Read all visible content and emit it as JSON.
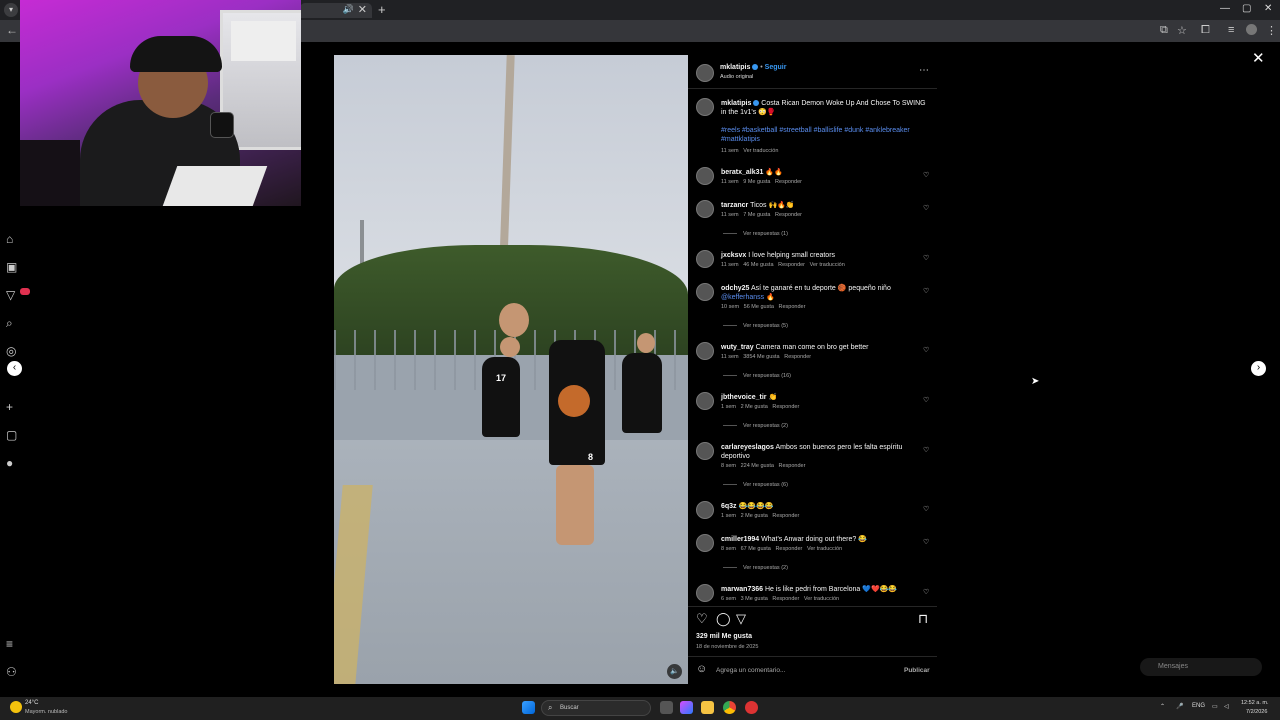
{
  "browser": {
    "tab_mute_icon": "speaker-icon",
    "tab_close": "✕",
    "new_tab": "+",
    "window_controls": [
      "—",
      "▢",
      "✕"
    ]
  },
  "post": {
    "author": "mklatipis",
    "follow": "Seguir",
    "audio": "Audio original",
    "caption_user": "mklatipis",
    "caption_text": "Costa Rican Demon Woke Up And Chose To SWING in the 1v1's 😳🥊",
    "hashtags": "#reels #basketball #streetball #ballislife #dunk #anklebreaker #mattklatipis",
    "caption_time": "11 sem",
    "caption_translate": "Ver traducción",
    "likes": "329 mil Me gusta",
    "date": "18 de noviembre de 2025",
    "comment_placeholder": "Agrega un comentario...",
    "publish": "Publicar"
  },
  "comments": [
    {
      "user": "beratx_alk31",
      "text": "🔥🔥",
      "time": "11 sem",
      "likes": "9 Me gusta",
      "reply": "Responder",
      "translate": "",
      "replies": ""
    },
    {
      "user": "tarzancr",
      "text": "Ticos 🙌🔥👏",
      "time": "11 sem",
      "likes": "7 Me gusta",
      "reply": "Responder",
      "translate": "",
      "replies": "Ver respuestas (1)"
    },
    {
      "user": "jxcksvx",
      "text": "I love helping small creators",
      "time": "11 sem",
      "likes": "46 Me gusta",
      "reply": "Responder",
      "translate": "Ver traducción",
      "replies": ""
    },
    {
      "user": "odchy25",
      "text": "Así te ganaré en tu deporte 🏀 pequeño niño",
      "mention": "@kefferhanss 🔥",
      "time": "10 sem",
      "likes": "56 Me gusta",
      "reply": "Responder",
      "translate": "",
      "replies": "Ver respuestas (5)"
    },
    {
      "user": "wuty_tray",
      "text": "Camera man come on bro get better",
      "time": "11 sem",
      "likes": "3854 Me gusta",
      "reply": "Responder",
      "translate": "",
      "replies": "Ver respuestas (16)"
    },
    {
      "user": "jbthevoice_tir",
      "text": "👏",
      "time": "1 sem",
      "likes": "2 Me gusta",
      "reply": "Responder",
      "translate": "",
      "replies": "Ver respuestas (2)"
    },
    {
      "user": "carlareyeslagos",
      "text": "Ambos son buenos pero les falta espíritu deportivo",
      "time": "8 sem",
      "likes": "224 Me gusta",
      "reply": "Responder",
      "translate": "",
      "replies": "Ver respuestas (6)"
    },
    {
      "user": "6q3z",
      "text": "😂😂😂😂",
      "time": "1 sem",
      "likes": "2 Me gusta",
      "reply": "Responder",
      "translate": "",
      "replies": ""
    },
    {
      "user": "cmiller1994",
      "text": "What's Anwar doing out there? 😂",
      "time": "8 sem",
      "likes": "67 Me gusta",
      "reply": "Responder",
      "translate": "Ver traducción",
      "replies": "Ver respuestas (2)"
    },
    {
      "user": "marwan7366",
      "text": "He is like pedri from Barcelona 💙❤️😂😂",
      "time": "6 sem",
      "likes": "3 Me gusta",
      "reply": "Responder",
      "translate": "Ver traducción",
      "replies": ""
    }
  ],
  "overlay": {
    "close": "✕",
    "prev": "‹",
    "next": "›",
    "messages": "Mensajes"
  },
  "jersey_numbers": [
    "17",
    "8"
  ],
  "taskbar": {
    "weather_temp": "24°C",
    "weather_desc": "Mayorm. nublado",
    "search_placeholder": "Buscar",
    "lang": "ENG",
    "time": "12:52 a. m.",
    "date": "7/2/2026"
  },
  "colors": {
    "accent": "#3897f0",
    "link": "#5a8dee",
    "badge": "#e03150"
  }
}
